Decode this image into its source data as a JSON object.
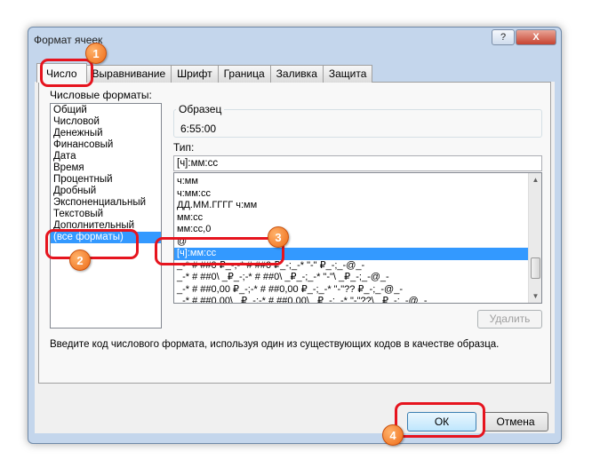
{
  "dialog": {
    "title": "Формат ячеек",
    "help_label": "?",
    "close_label": "X"
  },
  "tabs": [
    {
      "label": "Число"
    },
    {
      "label": "Выравнивание"
    },
    {
      "label": "Шрифт"
    },
    {
      "label": "Граница"
    },
    {
      "label": "Заливка"
    },
    {
      "label": "Защита"
    }
  ],
  "categories": {
    "label": "Числовые форматы:",
    "items": [
      "Общий",
      "Числовой",
      "Денежный",
      "Финансовый",
      "Дата",
      "Время",
      "Процентный",
      "Дробный",
      "Экспоненциальный",
      "Текстовый",
      "Дополнительный",
      "(все форматы)"
    ],
    "selected": "(все форматы)"
  },
  "sample": {
    "label": "Образец",
    "value": "6:55:00"
  },
  "type": {
    "label": "Тип:",
    "value": "[ч]:мм:сс"
  },
  "formats": {
    "items": [
      "ч:мм",
      "ч:мм:сс",
      "ДД.ММ.ГГГГ ч:мм",
      "мм:сс",
      "мм:сс,0",
      "@",
      "[ч]:мм:сс",
      "_-* # ##0 ₽_-;-* # ##0 ₽_-;_-* \"-\" ₽_-;_-@_-",
      "_-* # ##0\\ _₽_-;-* # ##0\\ _₽_-;_-* \"-\"\\ _₽_-;_-@_-",
      "_-* # ##0,00 ₽_-;-* # ##0,00 ₽_-;_-* \"-\"?? ₽_-;_-@_-",
      "_-* # ##0,00\\ _₽_-;-* # ##0,00\\ _₽_-;_-* \"-\"??\\ _₽_-;_-@_-"
    ],
    "selected": "[ч]:мм:сс"
  },
  "delete_label": "Удалить",
  "hint": "Введите код числового формата, используя один из существующих кодов в качестве образца.",
  "ok_label": "ОК",
  "cancel_label": "Отмена",
  "badges": [
    "1",
    "2",
    "3",
    "4"
  ],
  "colors": {
    "highlight": "#e6141e",
    "badge": "#ee6b16",
    "selection": "#3399ff"
  }
}
